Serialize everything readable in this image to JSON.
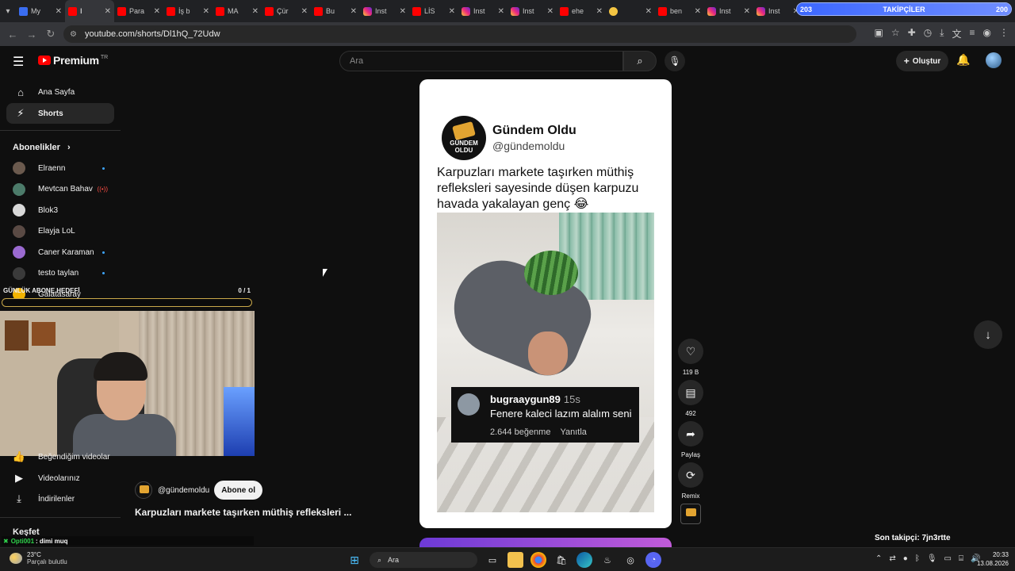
{
  "browser": {
    "tabs": [
      {
        "title": "My",
        "icon": "twitch-icon",
        "active": false
      },
      {
        "title": "I",
        "icon": "youtube-icon",
        "active": true
      },
      {
        "title": "Para",
        "icon": "youtube-icon",
        "active": false
      },
      {
        "title": "İş b",
        "icon": "youtube-icon",
        "active": false
      },
      {
        "title": "MA",
        "icon": "youtube-icon",
        "active": false
      },
      {
        "title": "Çür",
        "icon": "youtube-icon",
        "active": false
      },
      {
        "title": "Bu",
        "icon": "youtube-icon",
        "active": false
      },
      {
        "title": "Inst",
        "icon": "instagram-icon",
        "active": false
      },
      {
        "title": "LİS",
        "icon": "youtube-icon",
        "active": false
      },
      {
        "title": "Inst",
        "icon": "instagram-icon",
        "active": false
      },
      {
        "title": "Inst",
        "icon": "instagram-icon",
        "active": false
      },
      {
        "title": "ehe",
        "icon": "youtube-icon",
        "active": false
      },
      {
        "title": "",
        "icon": "emoji-icon",
        "active": false
      },
      {
        "title": "ben",
        "icon": "youtube-icon",
        "active": false
      },
      {
        "title": "Inst",
        "icon": "instagram-icon",
        "active": false
      },
      {
        "title": "Inst",
        "icon": "instagram-icon",
        "active": false
      }
    ],
    "url": "youtube.com/shorts/Dl1hQ_72Udw",
    "follower_goal": {
      "current": "203",
      "label": "TAKİPÇİLER",
      "target": "200",
      "progress": 1.0
    }
  },
  "header": {
    "logo_text": "Premium",
    "country_code": "TR",
    "search_placeholder": "Ara",
    "create_label": "Oluştur"
  },
  "sidebar": {
    "items": [
      {
        "label": "Ana Sayfa",
        "icon": "home-icon"
      },
      {
        "label": "Shorts",
        "icon": "shorts-icon"
      }
    ],
    "subscriptions_heading": "Abonelikler",
    "subscriptions": [
      {
        "name": "Elraenn",
        "badge": "dot",
        "color": "#6b5a4e"
      },
      {
        "name": "Mevtcan Bahav",
        "badge": "live",
        "color": "#4c7b6a"
      },
      {
        "name": "Blok3",
        "badge": "",
        "color": "#d8d8d8"
      },
      {
        "name": "Elayja LoL",
        "badge": "",
        "color": "#5a4a44"
      },
      {
        "name": "Caner Karaman",
        "badge": "dot",
        "color": "#9a6ad0"
      },
      {
        "name": "testo taylan",
        "badge": "dot",
        "color": "#3a3a3a"
      },
      {
        "name": "Galatasaray",
        "badge": "",
        "color": "#f2b400"
      }
    ],
    "lower_items": [
      {
        "label": "Beğendiğim videolar",
        "icon": "like-icon"
      },
      {
        "label": "Videolarınız",
        "icon": "video-icon"
      },
      {
        "label": "İndirilenler",
        "icon": "download-icon"
      }
    ],
    "explore_heading": "Keşfet"
  },
  "overlay": {
    "goal_label": "GÜNLÜK ABONE HEDEFİ",
    "goal_count": "0 / 1",
    "goal_progress": 0.0,
    "chat_user": "Opti001",
    "chat_message": ": dimi muq",
    "last_follower": "Son takipçi: 7jn3rtte"
  },
  "short": {
    "channel_name": "Gündem Oldu",
    "channel_handle": "@gündemoldu",
    "logo_text_top": "GÜNDEM",
    "logo_text_bottom": "OLDU",
    "caption": "Karpuzları markete taşırken müthiş refleksleri sayesinde düşen karpuzu havada yakalayan genç 😂",
    "comment": {
      "user": "bugraaygun89",
      "time": "15s",
      "text": "Fenere kaleci lazım alalım seni",
      "likes": "2.644 beğenme",
      "reply": "Yanıtla"
    },
    "below": {
      "handle": "@gündemoldu",
      "subscribe_label": "Abone ol",
      "title": "Karpuzları markete taşırken müthiş refleksleri ..."
    },
    "actions": [
      {
        "icon": "like-icon",
        "label": "119 B"
      },
      {
        "icon": "comment-icon",
        "label": "492"
      },
      {
        "icon": "share-icon",
        "label": "Paylaş"
      },
      {
        "icon": "remix-icon",
        "label": "Remix"
      }
    ]
  },
  "taskbar": {
    "temperature": "23°C",
    "weather": "Parçalı bulutlu",
    "search_label": "Ara",
    "time": "20:33",
    "date": "13.08.2026"
  },
  "colors": {
    "youtube_red": "#ff0000",
    "background": "#0f0f0f",
    "goal_gold": "#c9a84a",
    "follower_blue": "#3c67ff"
  }
}
